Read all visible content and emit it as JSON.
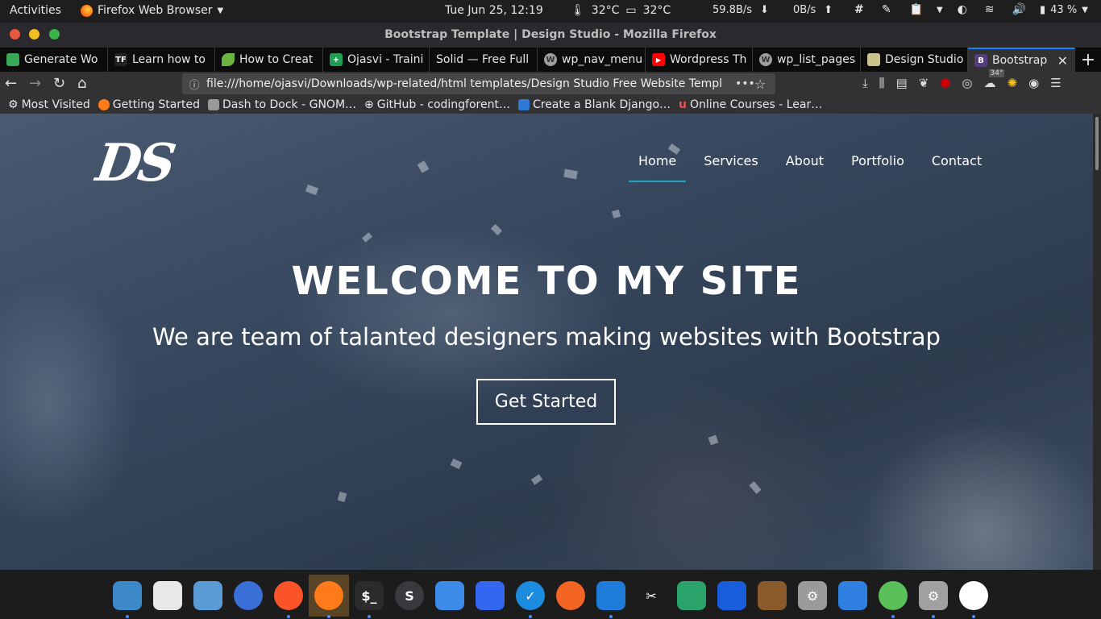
{
  "system": {
    "activities": "Activities",
    "app_menu": "Firefox Web Browser",
    "clock": "Tue Jun 25, 12:19",
    "cpu_temp": "32°C",
    "disk_temp": "32°C",
    "net_down": "59.8B/s",
    "net_up": "0B/s",
    "battery": "43 %"
  },
  "window": {
    "title": "Bootstrap Template | Design Studio - Mozilla Firefox"
  },
  "tabs": [
    {
      "label": "Generate Wo",
      "icon": "grid-icon",
      "color": "#3aa757"
    },
    {
      "label": "Learn how to",
      "icon": "tf-icon",
      "color": "#222222"
    },
    {
      "label": "How to Creat",
      "icon": "leaf-icon",
      "color": "#6db33f"
    },
    {
      "label": "Ojasvi - Traini",
      "icon": "plus-icon",
      "color": "#1f9d55"
    },
    {
      "label": "Solid — Free Full",
      "icon": "",
      "color": ""
    },
    {
      "label": "wp_nav_menu",
      "icon": "wordpress-icon",
      "color": "#9e9e9e"
    },
    {
      "label": "Wordpress Th",
      "icon": "youtube-icon",
      "color": "#ff0000"
    },
    {
      "label": "wp_list_pages",
      "icon": "wordpress-icon",
      "color": "#9e9e9e"
    },
    {
      "label": "Design Studio",
      "icon": "image-icon",
      "color": "#c9c28a"
    },
    {
      "label": "Bootstrap",
      "icon": "bootstrap-icon",
      "color": "#563d7c"
    }
  ],
  "nav": {
    "url": "file:///home/ojasvi/Downloads/wp-related/html templates/Design Studio Free Website Templ",
    "more": "•••",
    "badge": "34°"
  },
  "bookmarks": [
    {
      "label": "Most Visited",
      "icon": "gear-icon",
      "color": "#cccccc"
    },
    {
      "label": "Getting Started",
      "icon": "firefox-icon",
      "color": "#ff7a1a"
    },
    {
      "label": "Dash to Dock - GNOM…",
      "icon": "gnome-icon",
      "color": "#bbbbbb"
    },
    {
      "label": "GitHub - codingforent…",
      "icon": "globe-icon",
      "color": "#bbbbbb"
    },
    {
      "label": "Create a Blank Django…",
      "icon": "django-icon",
      "color": "#2e7bd6"
    },
    {
      "label": "Online Courses - Lear…",
      "icon": "udemy-icon",
      "color": "#ec5252"
    }
  ],
  "site": {
    "logo": "DS",
    "menu": [
      "Home",
      "Services",
      "About",
      "Portfolio",
      "Contact"
    ],
    "active_menu": "Home",
    "hero_title": "WELCOME TO MY SITE",
    "hero_subtitle": "We are team of talanted designers making websites with Bootstrap",
    "cta": "Get Started",
    "accent": "#1fa3c0"
  },
  "dock": [
    {
      "name": "image-viewer-icon",
      "color": "#3c88c8",
      "glyph": "",
      "active": false
    },
    {
      "name": "calendar-icon",
      "color": "#e8e8e8",
      "glyph": "",
      "active": false
    },
    {
      "name": "files-icon",
      "color": "#5b9bd5",
      "glyph": "",
      "active": false
    },
    {
      "name": "thunderbird-icon",
      "color": "#3a6fd8",
      "glyph": "",
      "active": false
    },
    {
      "name": "brave-icon",
      "color": "#fb542b",
      "glyph": "",
      "active": false
    },
    {
      "name": "firefox-icon",
      "color": "#ff7a1a",
      "glyph": "",
      "active": true
    },
    {
      "name": "terminal-icon",
      "color": "#2b2b2b",
      "glyph": "$_",
      "active": false
    },
    {
      "name": "simplenote-icon",
      "color": "#3a3a3e",
      "glyph": "S",
      "active": false
    },
    {
      "name": "toggle-app-icon",
      "color": "#3d8be8",
      "glyph": "",
      "active": false
    },
    {
      "name": "inbox-icon",
      "color": "#3367f0",
      "glyph": "",
      "active": false
    },
    {
      "name": "tasks-icon",
      "color": "#1b8ce0",
      "glyph": "✓",
      "active": false
    },
    {
      "name": "sync-icon",
      "color": "#f26522",
      "glyph": "",
      "active": false
    },
    {
      "name": "vscode-icon",
      "color": "#1f7bd8",
      "glyph": "",
      "active": false
    },
    {
      "name": "scissors-icon",
      "color": "#1c1c1c",
      "glyph": "✂",
      "active": false
    },
    {
      "name": "layers-icon",
      "color": "#2aa36b",
      "glyph": "",
      "active": false
    },
    {
      "name": "bitwarden-icon",
      "color": "#175ddc",
      "glyph": "",
      "active": false
    },
    {
      "name": "calibre-icon",
      "color": "#8a5a2b",
      "glyph": "",
      "active": false
    },
    {
      "name": "settings-icon",
      "color": "#9a9a9a",
      "glyph": "⚙",
      "active": false
    },
    {
      "name": "system-monitor-icon",
      "color": "#2f7fe0",
      "glyph": "",
      "active": false
    },
    {
      "name": "atom-icon",
      "color": "#5ac05a",
      "glyph": "",
      "active": false
    },
    {
      "name": "settings-icon",
      "color": "#a0a0a0",
      "glyph": "⚙",
      "active": false
    },
    {
      "name": "slack-icon",
      "color": "#ffffff",
      "glyph": "",
      "active": false
    }
  ]
}
